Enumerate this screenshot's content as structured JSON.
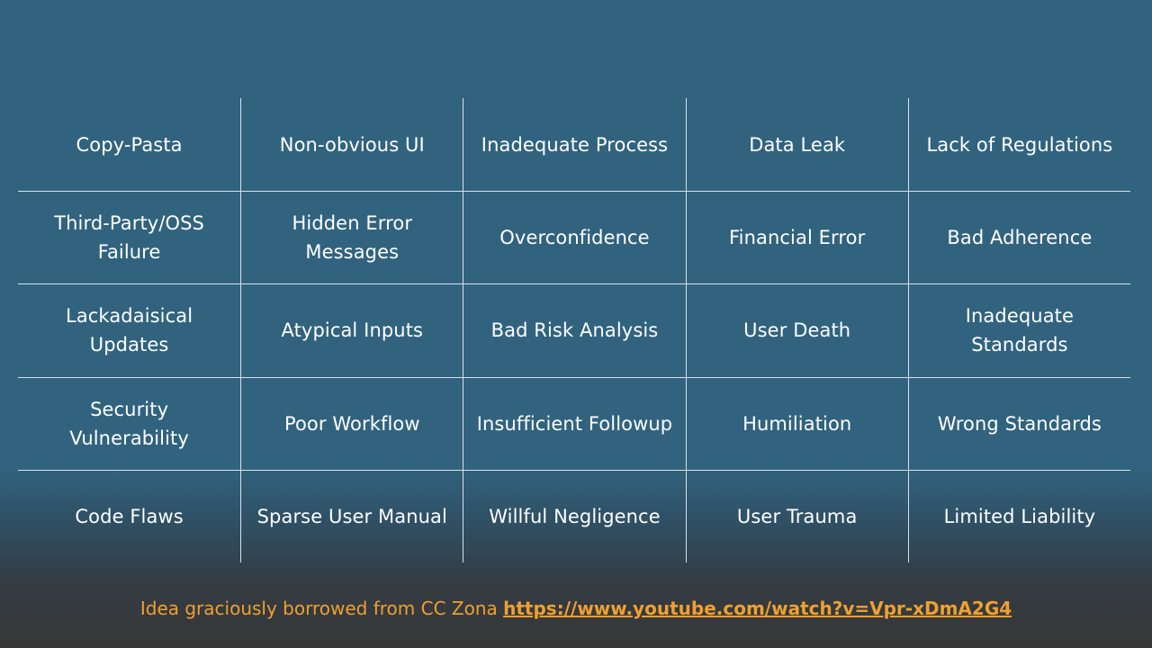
{
  "grid": {
    "rows": [
      [
        "Copy-Pasta",
        "Non-obvious UI",
        "Inadequate Process",
        "Data Leak",
        "Lack of Regulations"
      ],
      [
        "Third-Party/OSS\nFailure",
        "Hidden Error\nMessages",
        "Overconfidence",
        "Financial Error",
        "Bad Adherence"
      ],
      [
        "Lackadaisical\nUpdates",
        "Atypical Inputs",
        "Bad Risk Analysis",
        "User Death",
        "Inadequate\nStandards"
      ],
      [
        "Security\nVulnerability",
        "Poor Workflow",
        "Insufficient Followup",
        "Humiliation",
        "Wrong Standards"
      ],
      [
        "Code Flaws",
        "Sparse User Manual",
        "Willful Negligence",
        "User Trauma",
        "Limited Liability"
      ]
    ]
  },
  "footer": {
    "text": "Idea graciously borrowed from CC Zona ",
    "link": "https://www.youtube.com/watch?v=Vpr-xDmA2G4"
  },
  "colors": {
    "background": "#31637f",
    "footer_text": "#f0a030",
    "grid_lines": "#d9e2e8"
  }
}
